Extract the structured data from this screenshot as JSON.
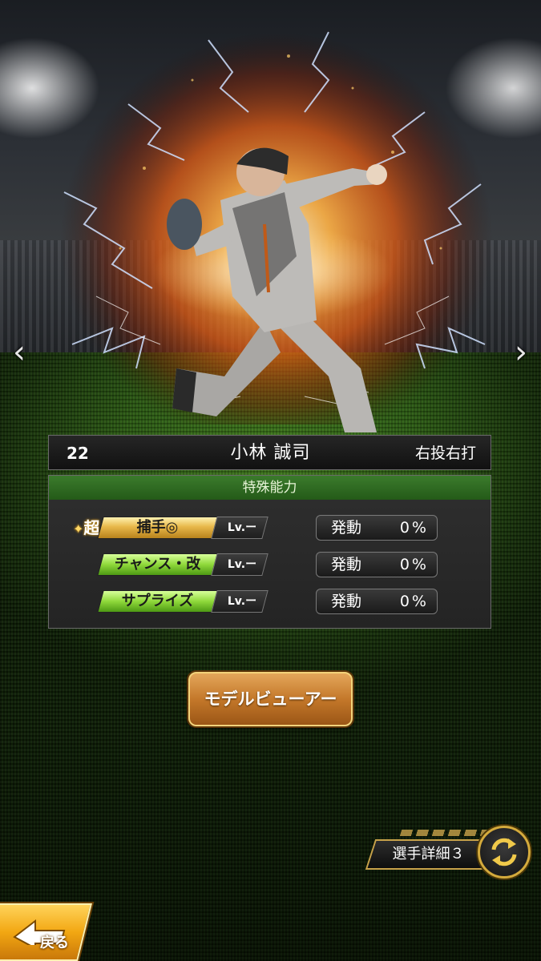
{
  "player": {
    "number": "22",
    "name": "小林 誠司",
    "handedness": "右投右打"
  },
  "abilities": {
    "header": "特殊能力",
    "super_mark": "超",
    "items": [
      {
        "name": "捕手◎",
        "level": "Lv.ー",
        "activate_label": "発動",
        "activate_rate": "0%",
        "tier": "gold"
      },
      {
        "name": "チャンス・改",
        "level": "Lv.ー",
        "activate_label": "発動",
        "activate_rate": "0%",
        "tier": "green"
      },
      {
        "name": "サプライズ",
        "level": "Lv.ー",
        "activate_label": "発動",
        "activate_rate": "0%",
        "tier": "green"
      }
    ]
  },
  "buttons": {
    "model_viewer": "モデルビューアー",
    "player_detail": "選手詳細３",
    "back": "戻る"
  },
  "icons": {
    "prev": "chevron-left-icon",
    "next": "chevron-right-icon",
    "cycle": "cycle-arrows-icon",
    "back": "back-arrow-icon"
  },
  "colors": {
    "gold": "#e8b84a",
    "green": "#8fd83a",
    "header_green": "#2f6b22",
    "button_orange": "#c4782a"
  }
}
